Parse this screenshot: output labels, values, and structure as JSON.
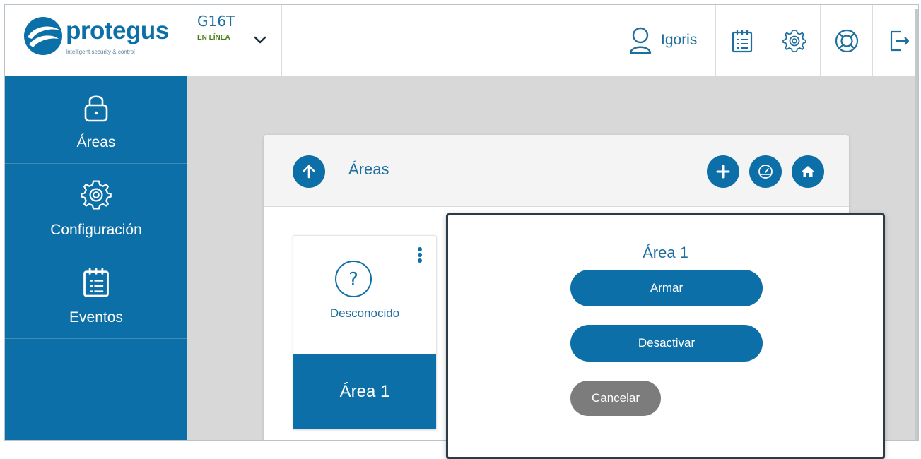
{
  "brand": {
    "name": "protegus",
    "tagline": "Intelligent security & control"
  },
  "device": {
    "name": "G16T",
    "status": "EN LÍNEA"
  },
  "user": {
    "name": "Igoris"
  },
  "header_icons": [
    "calendar-list-icon",
    "gear-icon",
    "lifebuoy-icon",
    "logout-icon"
  ],
  "sidebar": {
    "items": [
      {
        "label": "Áreas",
        "icon": "padlock-icon"
      },
      {
        "label": "Configuración",
        "icon": "gear-icon"
      },
      {
        "label": "Eventos",
        "icon": "calendar-list-icon"
      }
    ]
  },
  "panel": {
    "title": "Áreas",
    "actions": [
      "add-icon",
      "gauge-icon",
      "home-icon"
    ]
  },
  "area_card": {
    "state": "Desconocido",
    "name": "Área 1"
  },
  "modal": {
    "title": "Área 1",
    "arm_label": "Armar",
    "disarm_label": "Desactivar",
    "cancel_label": "Cancelar"
  },
  "colors": {
    "primary": "#0d6fa7",
    "status_online": "#4f7c1a",
    "cancel": "#7c7c7c"
  }
}
